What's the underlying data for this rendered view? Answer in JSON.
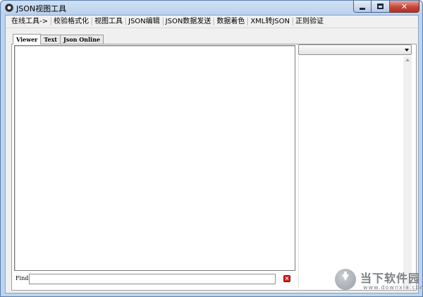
{
  "window": {
    "title": "JSON视图工具"
  },
  "menubar": {
    "items": [
      {
        "label": "在线工具->"
      },
      {
        "label": "校验格式化"
      },
      {
        "label": "视图工具"
      },
      {
        "label": "JSON编辑"
      },
      {
        "label": "JSON数据发送"
      },
      {
        "label": "数据着色"
      },
      {
        "label": "XML转JSON"
      },
      {
        "label": "正则验证"
      }
    ]
  },
  "tabs": [
    {
      "label": "Viewer",
      "active": true
    },
    {
      "label": "Text",
      "active": false
    },
    {
      "label": "Json Online",
      "active": false
    }
  ],
  "side_panel": {
    "combo_value": ""
  },
  "find": {
    "label": "Find",
    "value": ""
  },
  "watermark": {
    "title": "当下软件园",
    "url": "www.downxia.com"
  },
  "colors": {
    "title_gradient_top": "#cfe0f3",
    "close_button": "#c7463a",
    "client_bg": "#f0f0f0",
    "clear_button": "#d42020"
  }
}
